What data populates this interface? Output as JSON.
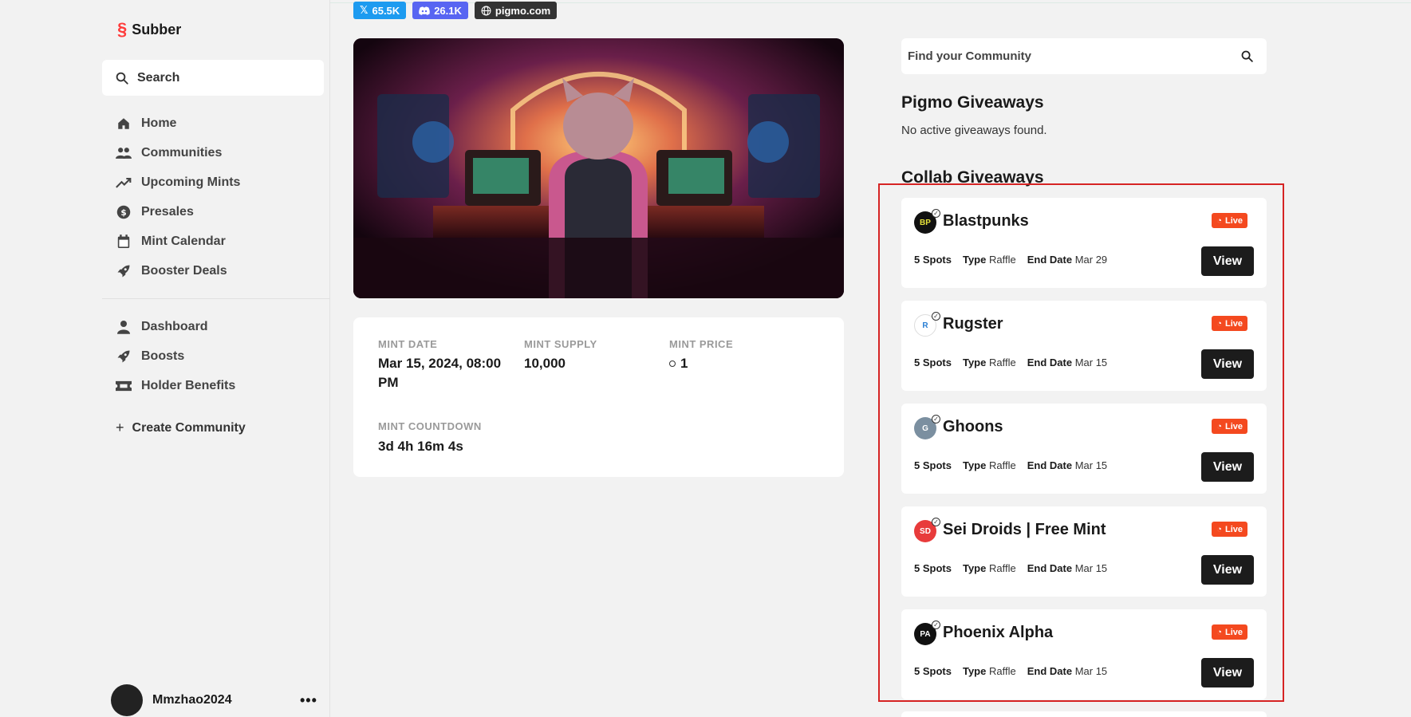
{
  "app": {
    "name": "Subber"
  },
  "sidebar": {
    "search_label": "Search",
    "nav_primary": [
      {
        "label": "Home",
        "icon": "home-icon"
      },
      {
        "label": "Communities",
        "icon": "users-icon"
      },
      {
        "label": "Upcoming Mints",
        "icon": "trending-icon"
      },
      {
        "label": "Presales",
        "icon": "dollar-icon"
      },
      {
        "label": "Mint Calendar",
        "icon": "calendar-icon"
      },
      {
        "label": "Booster Deals",
        "icon": "rocket-icon"
      }
    ],
    "nav_secondary": [
      {
        "label": "Dashboard",
        "icon": "person-icon"
      },
      {
        "label": "Boosts",
        "icon": "rocket-icon"
      },
      {
        "label": "Holder Benefits",
        "icon": "ticket-icon"
      }
    ],
    "create_label": "Create Community",
    "user": {
      "name": "Mmzhao2024"
    }
  },
  "social": {
    "x_count": "65.5K",
    "discord_count": "26.1K",
    "website": "pigmo.com"
  },
  "mint": {
    "date_label": "MINT DATE",
    "date_value": "Mar 15, 2024, 08:00 PM",
    "supply_label": "MINT SUPPLY",
    "supply_value": "10,000",
    "price_label": "MINT PRICE",
    "price_value": "1",
    "countdown_label": "MINT COUNTDOWN",
    "countdown_value": "3d 4h 16m 4s"
  },
  "right": {
    "find_placeholder": "Find your Community",
    "pigmo_title": "Pigmo Giveaways",
    "pigmo_empty": "No active giveaways found.",
    "collab_title": "Collab Giveaways",
    "live_label": "Live",
    "type_label": "Type",
    "end_label": "End Date",
    "view_label": "View",
    "giveaways": [
      {
        "name": "Blastpunks",
        "spots": "5 Spots",
        "type": "Raffle",
        "end": "Mar 29",
        "logo_color": "#111111",
        "logo_text": "BP"
      },
      {
        "name": "Rugster",
        "spots": "5 Spots",
        "type": "Raffle",
        "end": "Mar 15",
        "logo_color": "#ffffff",
        "logo_text": "R"
      },
      {
        "name": "Ghoons",
        "spots": "5 Spots",
        "type": "Raffle",
        "end": "Mar 15",
        "logo_color": "#7b8fa0",
        "logo_text": "G"
      },
      {
        "name": "Sei Droids | Free Mint",
        "spots": "5 Spots",
        "type": "Raffle",
        "end": "Mar 15",
        "logo_color": "#e83b3b",
        "logo_text": "SD"
      },
      {
        "name": "Phoenix Alpha",
        "spots": "5 Spots",
        "type": "Raffle",
        "end": "Mar 15",
        "logo_color": "#111111",
        "logo_text": "PA"
      }
    ]
  },
  "colors": {
    "accent_red": "#ff3b3b",
    "live_orange": "#f4491f",
    "highlight_border": "#d62424",
    "x_blue": "#1d9bf0",
    "discord": "#5865f2"
  }
}
